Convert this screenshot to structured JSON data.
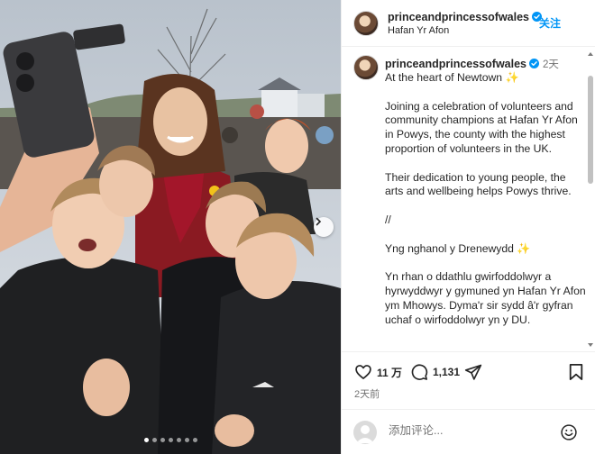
{
  "photo": {
    "slide_count": 7,
    "active_slide": 1
  },
  "header": {
    "username": "princeandprincessofwales",
    "follow_label": "关注",
    "location": "Hafan Yr Afon"
  },
  "caption": {
    "username": "princeandprincessofwales",
    "time_ago": "2天",
    "paragraphs": [
      "At the heart of Newtown ✨",
      "Joining a celebration of volunteers and community champions at Hafan Yr Afon in Powys, the county with the highest proportion of volunteers in the UK.",
      "Their dedication to young people, the arts and wellbeing helps Powys thrive.",
      "//",
      "Yng nghanol y Drenewydd ✨",
      "Yn rhan o ddathlu gwirfoddolwyr a hyrwyddwyr y gymuned yn Hafan Yr Afon ym Mhowys. Dyma'r sir sydd â'r gyfran uchaf o wirfoddolwyr yn y DU."
    ]
  },
  "actions": {
    "likes": "11 万",
    "comments": "1,131"
  },
  "posted": "2天前",
  "comment_box": {
    "placeholder": "添加评论..."
  },
  "colors": {
    "accent": "#0095f6",
    "verified": "#0095f6",
    "scarf": "#a3162a"
  },
  "icons": [
    "verified-badge-icon",
    "heart-icon",
    "comment-icon",
    "share-icon",
    "bookmark-icon",
    "emoji-icon",
    "chevron-right-icon"
  ]
}
